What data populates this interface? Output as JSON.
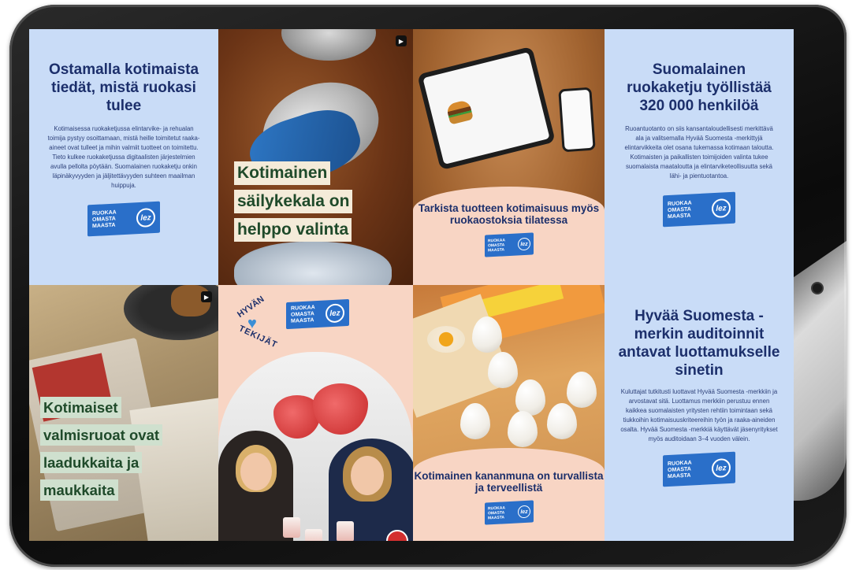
{
  "brand_logo": {
    "line1": "RUOKAA",
    "line2": "OMASTA",
    "line3": "MAASTA",
    "seal": "lez"
  },
  "tiles": {
    "t1": {
      "title": "Ostamalla kotimaista tiedät, mistä ruokasi tulee",
      "body": "Kotimaisessa ruokaketjussa elintarvike- ja rehualan toimija pystyy osoittamaan, mistä heille toimitetut raaka-aineet ovat tulleet ja mihin valmiit tuotteet on toimitettu. Tieto kulkee ruokaketjussa digitaalisten järjestelmien avulla pellolta pöytään. Suomalainen ruokaketju onkin läpinäkyvyyden ja jäljitettävyyden suhteen maailman huippuja."
    },
    "t2": {
      "lines": [
        "Kotimainen",
        "säilykekala on",
        "helppo valinta"
      ]
    },
    "t3": {
      "title": "Tarkista tuotteen kotimaisuus myös ruokaostoksia tilatessa"
    },
    "t4": {
      "title": "Suomalainen ruokaketju työllistää 320 000 henkilöä",
      "body": "Ruoantuotanto on siis kansantaloudellisesti merkittävä ala ja valitsemalla Hyvää Suomesta -merkittyjä elintarvikkeita olet osana tukemassa kotimaan taloutta. Kotimaisten ja paikallisten toimijoiden valinta tukee suomalaista maataloutta ja elintarviketeollisuutta sekä lähi- ja pientuotantoa."
    },
    "t5": {
      "lines": [
        "Kotimaiset",
        "valmisruoat ovat",
        "laadukkaita ja",
        "maukkaita"
      ]
    },
    "t6": {
      "badge_top": "HYVÄN",
      "badge_bottom": "TEKIJÄT"
    },
    "t7": {
      "title": "Kotimainen kananmuna on turvallista ja terveellistä"
    },
    "t8": {
      "title": "Hyvää Suomesta -merkin auditoinnit antavat luottamukselle sinetin",
      "body": "Kuluttajat tutkitusti luottavat Hyvää Suomesta -merkkiin ja arvostavat sitä. Luottamus merkkiin perustuu ennen kaikkea suomalaisten yritysten rehtiin toimintaan sekä tiukkoihin kotimaisuuskriteereihin työn ja raaka-aineiden osalta. Hyvää Suomesta -merkkiä käyttävät jäsenyritykset myös auditoidaan 3–4 vuoden välein."
    }
  },
  "icons": {
    "video": "play-icon",
    "heart": "heart-icon"
  },
  "colors": {
    "blue_tile": "#c9dcf7",
    "navy_text": "#1c2f6b",
    "pink_tile": "#f8d5c4",
    "logo_blue": "#2a6fc9"
  }
}
